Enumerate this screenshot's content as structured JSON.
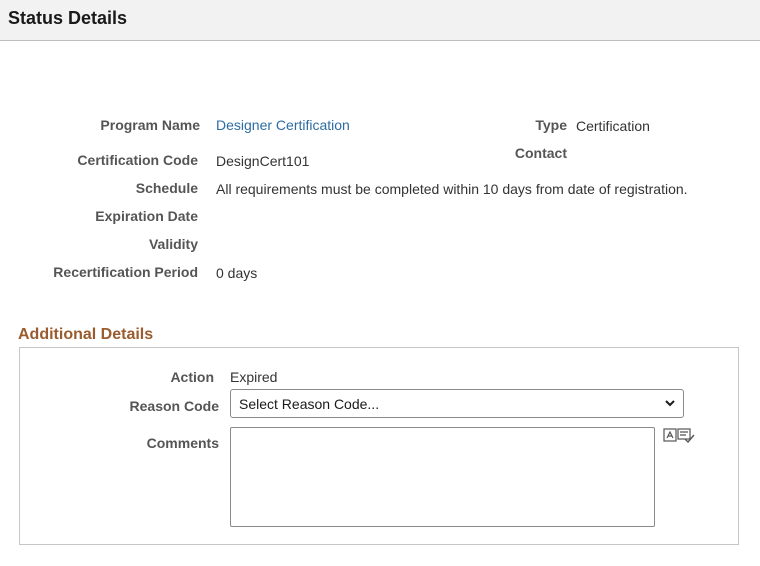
{
  "header": {
    "title": "Status Details"
  },
  "details": {
    "program_name": {
      "label": "Program Name",
      "value": "Designer Certification"
    },
    "type": {
      "label": "Type",
      "value": "Certification"
    },
    "certification_code": {
      "label": "Certification Code",
      "value": "DesignCert101"
    },
    "contact": {
      "label": "Contact",
      "value": ""
    },
    "schedule": {
      "label": "Schedule",
      "value": "All requirements must be completed within 10 days from date of registration."
    },
    "expiration_date": {
      "label": "Expiration Date",
      "value": ""
    },
    "validity": {
      "label": "Validity",
      "value": ""
    },
    "recertification_period": {
      "label": "Recertification Period",
      "value": "0 days"
    }
  },
  "additional": {
    "title": "Additional Details",
    "action": {
      "label": "Action",
      "value": "Expired"
    },
    "reason_code": {
      "label": "Reason Code",
      "selected": "Select Reason Code..."
    },
    "comments": {
      "label": "Comments",
      "value": ""
    },
    "spellcheck_icon": "spell-check-icon"
  },
  "colors": {
    "link": "#2d6ca2",
    "section_title": "#9a5b2e",
    "header_bg": "#f2f2f2"
  }
}
